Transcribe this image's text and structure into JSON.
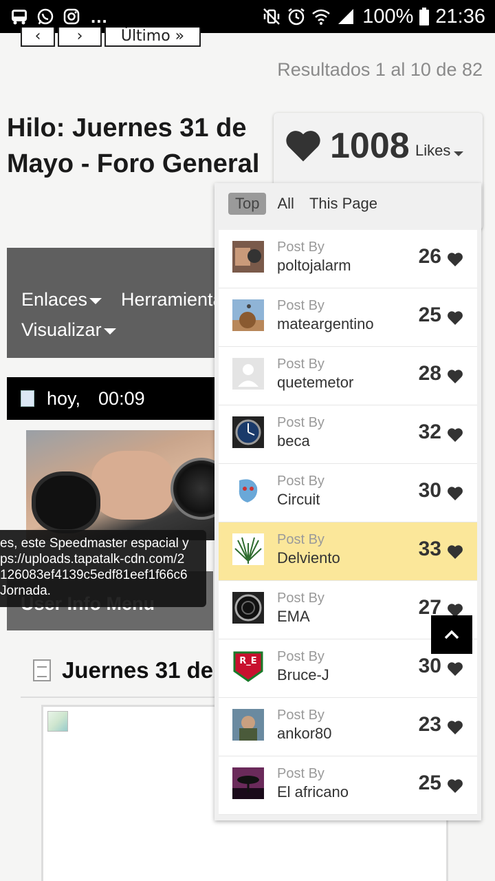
{
  "status_bar": {
    "left_icons": [
      "bus-icon",
      "whatsapp-icon",
      "instagram-icon"
    ],
    "overflow": "...",
    "battery": "100%",
    "time": "21:36"
  },
  "pager": {
    "first": "‹",
    "prev": "›",
    "last": "Último »"
  },
  "results_text": "Resultados 1 al 10 de 82",
  "thread": {
    "title": "Hilo: Juernes 31 de Mayo - Foro General"
  },
  "toolbar": {
    "links": "Enlaces",
    "tools": "Herramientas",
    "view": "Visualizar"
  },
  "post_header": {
    "date": "hoy,",
    "time": "00:09"
  },
  "tooltip": {
    "line1": "es, este Speedmaster espacial y",
    "line2": "ps://uploads.tapatalk-cdn.com/2",
    "line3": "126083ef4139c5edf81eef1f66c6",
    "line4": "Jornada."
  },
  "user_menu": "User Info Menu",
  "post_title": "Juernes 31 de",
  "likes": {
    "count": "1008",
    "label": "Likes",
    "tabs": [
      "Top",
      "All",
      "This Page"
    ],
    "post_by": "Post By",
    "list": [
      {
        "user": "poltojalarm",
        "count": "26",
        "highlight": false
      },
      {
        "user": "mateargentino",
        "count": "25",
        "highlight": false
      },
      {
        "user": "quetemetor",
        "count": "28",
        "highlight": false
      },
      {
        "user": "beca",
        "count": "32",
        "highlight": false
      },
      {
        "user": "Circuit",
        "count": "30",
        "highlight": false
      },
      {
        "user": "Delviento",
        "count": "33",
        "highlight": true
      },
      {
        "user": "EMA",
        "count": "27",
        "highlight": false
      },
      {
        "user": "Bruce-J",
        "count": "30",
        "highlight": false
      },
      {
        "user": "ankor80",
        "count": "23",
        "highlight": false
      },
      {
        "user": "El africano",
        "count": "25",
        "highlight": false
      }
    ]
  },
  "colors": {
    "highlight": "#fbe79a",
    "toolbar": "#5f5f5f",
    "heart": "#333333"
  }
}
